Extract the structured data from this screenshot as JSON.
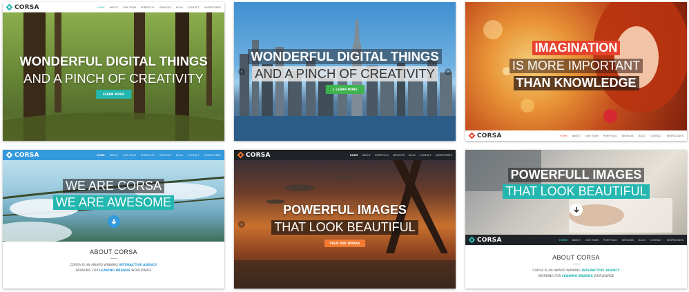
{
  "brand": {
    "name": "CORSA"
  },
  "nav_items": [
    "HOME",
    "ABOUT",
    "OUR TEAM",
    "PORTFOLIO",
    "SERVICES",
    "BLOG",
    "CONTACT",
    "SHORTCODES"
  ],
  "colors": {
    "teal": "#23b7b0",
    "green": "#3fb34f",
    "orange": "#f37a30",
    "blue": "#3399dd",
    "dark_nav": "#1f2327"
  },
  "cards": [
    {
      "headline": "WONDERFUL DIGITAL THINGS",
      "sub": "AND A PINCH OF CREATIVITY",
      "button": "LEARN MORE"
    },
    {
      "headline": "WONDERFUL DIGITAL THINGS",
      "sub": "AND A PINCH OF CREATIVITY",
      "button": "LEARN MORE"
    },
    {
      "line1": "IMAGINATION",
      "line2": "IS MORE IMPORTANT",
      "line3": "THAN KNOWLEDGE"
    },
    {
      "headline": "WE ARE CORSA",
      "sub": "WE ARE AWESOME"
    },
    {
      "headline": "POWERFUL IMAGES",
      "sub": "THAT LOOK BEAUTIFUL",
      "button": "VIEW OUR WORKS"
    },
    {
      "headline": "POWERFULL IMAGES",
      "sub": "THAT LOOK BEAUTIFUL"
    }
  ],
  "about": {
    "title": "ABOUT CORSA",
    "line1_pre": "CORSA IS AN AWARD WINNING ",
    "line1_hl": "INTERACTIVE AGENCY",
    "line2_pre": "WORKING FOR ",
    "line2_hl": "LEADING BRANDS",
    "line2_post": " WORLDWIDE"
  },
  "icons": [
    "corsa-logo-icon",
    "arrow-down-icon",
    "arrow-left-icon",
    "arrow-right-icon"
  ]
}
